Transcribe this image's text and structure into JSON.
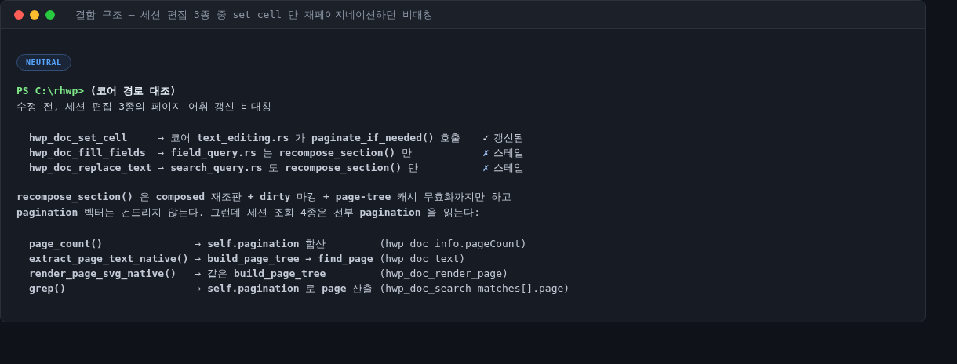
{
  "window": {
    "title": "결함 구조 — 세션 편집 3종 중 set_cell 만 재페이지네이션하던 비대칭"
  },
  "badge": {
    "label": "NEUTRAL"
  },
  "prompt": {
    "path": "PS C:\\rhwp>",
    "command": "(코어 경로 대조)"
  },
  "subtitle": "수정 전, 세션 편집 3종의 페이지 어휘 갱신 비대칭",
  "edit_rows": [
    {
      "name": "hwp_doc_set_cell",
      "path": "→ 코어 **text_editing.rs** 가 **paginate_if_needed()** 호출",
      "kind": "ok",
      "mark": "✓",
      "status": "갱신됨"
    },
    {
      "name": "hwp_doc_fill_fields",
      "path": "→ **field_query.rs** 는 **recompose_section()** 만",
      "kind": "stale",
      "mark": "✗",
      "status": "스테일"
    },
    {
      "name": "hwp_doc_replace_text",
      "path": "→ **search_query.rs** 도 **recompose_section()** 만",
      "kind": "stale",
      "mark": "✗",
      "status": "스테일"
    }
  ],
  "paragraph": [
    "**recompose_section()** 은 **composed** 재조판 **+ dirty** 마킹 **+ page-tree** 캐시 무효화까지만 하고",
    "**pagination** 벡터는 건드리지 않는다. 그런데 세션 조회 4종은 전부 **pagination** 을 읽는다:"
  ],
  "query_rows": [
    {
      "name": "page_count()",
      "path": "→ **self.pagination** 합산",
      "tool": "(hwp_doc_info.pageCount)"
    },
    {
      "name": "extract_page_text_native()",
      "path": "→ **build_page_tree → find_page**",
      "tool": "(hwp_doc_text)"
    },
    {
      "name": "render_page_svg_native()",
      "path": "→ 같은 **build_page_tree**",
      "tool": "(hwp_doc_render_page)"
    },
    {
      "name": "grep()",
      "path": "→ **self.pagination** 로 **page** 산출",
      "tool": "(hwp_doc_search matches[].page)"
    }
  ]
}
